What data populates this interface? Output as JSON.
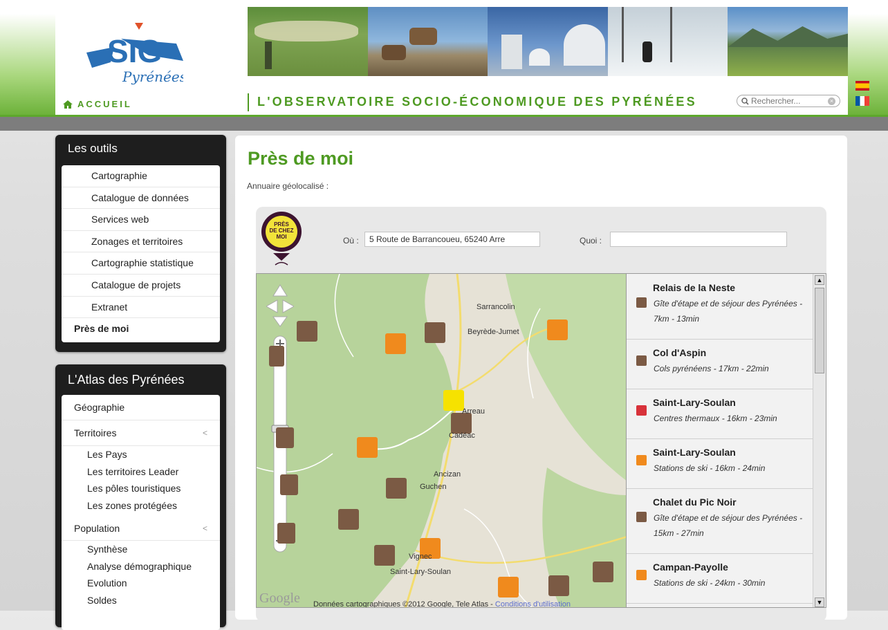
{
  "header": {
    "accueil": "ACCUEIL",
    "tagline": "L'OBSERVATOIRE SOCIO-ÉCONOMIQUE DES PYRÉNÉES",
    "search_placeholder": "Rechercher..."
  },
  "logo": {
    "text_main": "SIG",
    "text_script": "Pyrénées"
  },
  "sidebar": {
    "outils": {
      "title": "Les outils",
      "items": [
        "Cartographie",
        "Catalogue de données",
        "Services web",
        "Zonages et territoires",
        "Cartographie statistique",
        "Catalogue de projets",
        "Extranet"
      ],
      "active": "Près de moi"
    },
    "atlas": {
      "title": "L'Atlas des Pyrénées",
      "geographie": "Géographie",
      "territoires": {
        "label": "Territoires",
        "items": [
          "Les Pays",
          "Les territoires Leader",
          "Les pôles touristiques",
          "Les zones protégées"
        ]
      },
      "population": {
        "label": "Population",
        "items": [
          "Synthèse",
          "Analyse démographique",
          "Evolution",
          "Soldes"
        ]
      }
    }
  },
  "main": {
    "title": "Près de moi",
    "subtitle": "Annuaire géolocalisé :",
    "logo_text": [
      "PRÈS",
      "DE CHEZ",
      "MOI"
    ],
    "ou_label": "Où :",
    "ou_value": "5 Route de Barrancoueu, 65240 Arre",
    "quoi_label": "Quoi :",
    "quoi_value": ""
  },
  "map": {
    "towns": [
      "Sarrancolin",
      "Beyrède-Jumet",
      "Arreau",
      "Cadéac",
      "Ancizan",
      "Guchen",
      "Vignec",
      "Saint-Lary-Soulan"
    ],
    "copyright": "Données cartographiques ©2012 Google, Tele Atlas - ",
    "terms": "Conditions d'utilisation",
    "google": "Google"
  },
  "results": [
    {
      "name": "Relais de la Neste",
      "desc": "Gîte d'étape et de séjour des Pyrénées - 7km - 13min",
      "color": "#7b5a44"
    },
    {
      "name": "Col d'Aspin",
      "desc": "Cols pyrénéens - 17km - 22min",
      "color": "#7b5a44"
    },
    {
      "name": "Saint-Lary-Soulan",
      "desc": "Centres thermaux - 16km - 23min",
      "color": "#d8323a"
    },
    {
      "name": "Saint-Lary-Soulan",
      "desc": "Stations de ski - 16km - 24min",
      "color": "#f08a1d"
    },
    {
      "name": "Chalet du Pic Noir",
      "desc": "Gîte d'étape et de séjour des Pyrénées - 15km - 27min",
      "color": "#7b5a44"
    },
    {
      "name": "Campan-Payolle",
      "desc": "Stations de ski - 24km - 30min",
      "color": "#f08a1d"
    }
  ]
}
